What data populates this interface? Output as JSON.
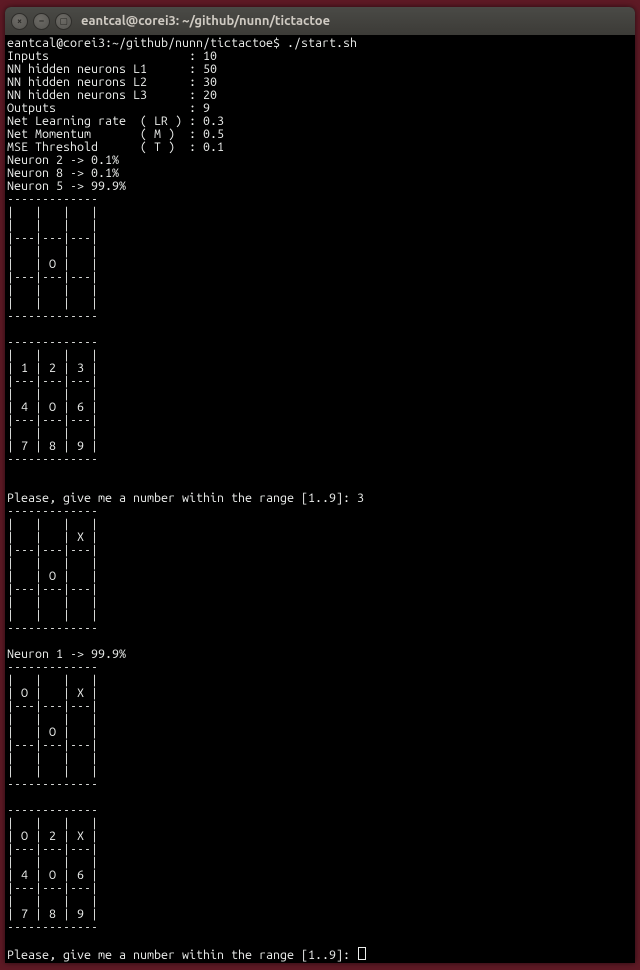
{
  "window": {
    "title": "eantcal@corei3: ~/github/nunn/tictactoe"
  },
  "prompt": {
    "line": "eantcal@corei3:~/github/nunn/tictactoe$ ./start.sh"
  },
  "params": [
    {
      "label": "Inputs                    ",
      "value": ": 10"
    },
    {
      "label": "NN hidden neurons L1      ",
      "value": ": 50"
    },
    {
      "label": "NN hidden neurons L2      ",
      "value": ": 30"
    },
    {
      "label": "NN hidden neurons L3      ",
      "value": ": 20"
    },
    {
      "label": "Outputs                   ",
      "value": ": 9"
    },
    {
      "label": "Net Learning rate  ( LR ) ",
      "value": ": 0.3"
    },
    {
      "label": "Net Momentum       ( M )  ",
      "value": ": 0.5"
    },
    {
      "label": "MSE Threshold      ( T )  ",
      "value": ": 0.1"
    }
  ],
  "neurons1": [
    "Neuron 2 -> 0.1%",
    "Neuron 8 -> 0.1%",
    "Neuron 5 -> 99.9%"
  ],
  "board1": [
    "-------------",
    "|   |   |   |",
    "|   |   |   |",
    "|---|---|---|",
    "|   |   |   |",
    "|   | O |   |",
    "|---|---|---|",
    "|   |   |   |",
    "|   |   |   |",
    "-------------"
  ],
  "board2": [
    "-------------",
    "|   |   |   |",
    "| 1 | 2 | 3 |",
    "|---|---|---|",
    "|   |   |   |",
    "| 4 | O | 6 |",
    "|---|---|---|",
    "|   |   |   |",
    "| 7 | 8 | 9 |",
    "-------------"
  ],
  "ask1": "Please, give me a number within the range [1..9]: 3",
  "board3": [
    "-------------",
    "|   |   |   |",
    "|   |   | X |",
    "|---|---|---|",
    "|   |   |   |",
    "|   | O |   |",
    "|---|---|---|",
    "|   |   |   |",
    "|   |   |   |",
    "-------------"
  ],
  "neurons2": [
    "Neuron 1 -> 99.9%"
  ],
  "board4": [
    "-------------",
    "|   |   |   |",
    "| O |   | X |",
    "|---|---|---|",
    "|   |   |   |",
    "|   | O |   |",
    "|---|---|---|",
    "|   |   |   |",
    "|   |   |   |",
    "-------------"
  ],
  "board5": [
    "-------------",
    "|   |   |   |",
    "| O | 2 | X |",
    "|---|---|---|",
    "|   |   |   |",
    "| 4 | O | 6 |",
    "|---|---|---|",
    "|   |   |   |",
    "| 7 | 8 | 9 |",
    "-------------"
  ],
  "ask2": "Please, give me a number within the range [1..9]: "
}
